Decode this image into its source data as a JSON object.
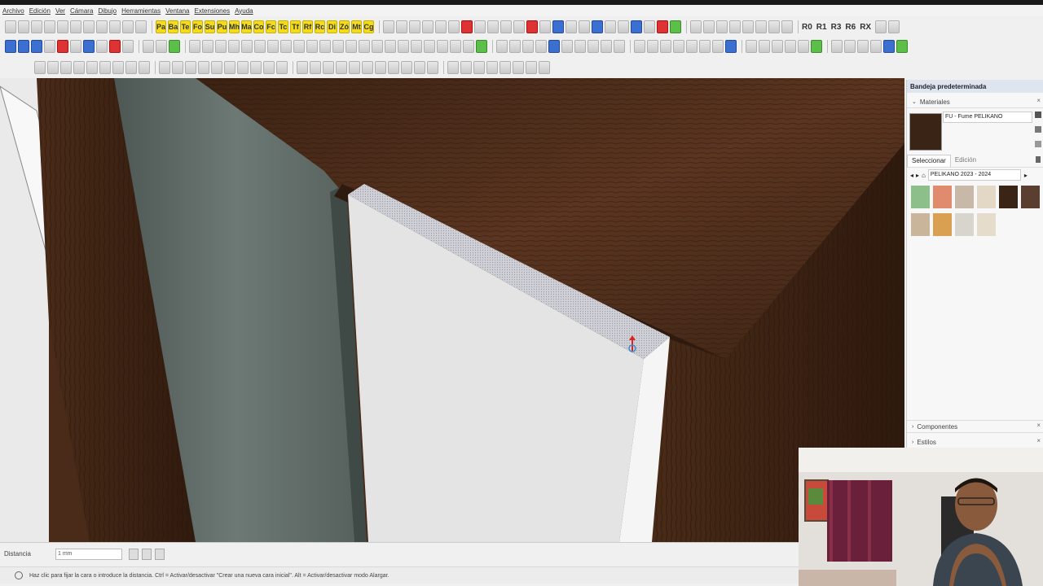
{
  "menu": [
    "Archivo",
    "Edición",
    "Ver",
    "Cámara",
    "Dibujo",
    "Herramientas",
    "Ventana",
    "Extensiones",
    "Ayuda"
  ],
  "toolbar1": {
    "yellow_buttons": [
      "Pa",
      "Ba",
      "Te",
      "Fo",
      "Su",
      "Pu",
      "Mh",
      "Ma",
      "Co",
      "Fc",
      "Tc",
      "Tf",
      "Rf",
      "Rc",
      "Di",
      "Zó",
      "Mt",
      "Cg"
    ],
    "right_labels": [
      "R0",
      "R1",
      "R3",
      "R6",
      "RX"
    ]
  },
  "tray": {
    "title": "Bandeja predeterminada",
    "materials_header": "Materiales",
    "current_material": "FU - Fume PELIKANO",
    "tab_select": "Seleccionar",
    "tab_edit": "Edición",
    "library": "PELIKANO 2023 - 2024",
    "components_header": "Componentes",
    "styles_header": "Estilos"
  },
  "swatch_colors": [
    "#8dbf8a",
    "#e08a6e",
    "#c7b8a8",
    "#e3d8c6",
    "#3a2416",
    "#5a3f30",
    "#c9b69a",
    "#d9a052",
    "#d8d4ce",
    "#e6dccb"
  ],
  "status": {
    "distance_label": "Distancia",
    "distance_value": "1 mm",
    "hint": "Haz clic para fijar la cara o introduce la distancia. Ctrl = Activar/desactivar \"Crear una nueva cara inicial\". Alt = Activar/desactivar modo Alargar."
  },
  "colors": {
    "wood_dark": "#4a2a18",
    "panel_grey": "#5f6a66",
    "board_white": "#e6e6e6",
    "tray_title": "#dfe5ee"
  }
}
